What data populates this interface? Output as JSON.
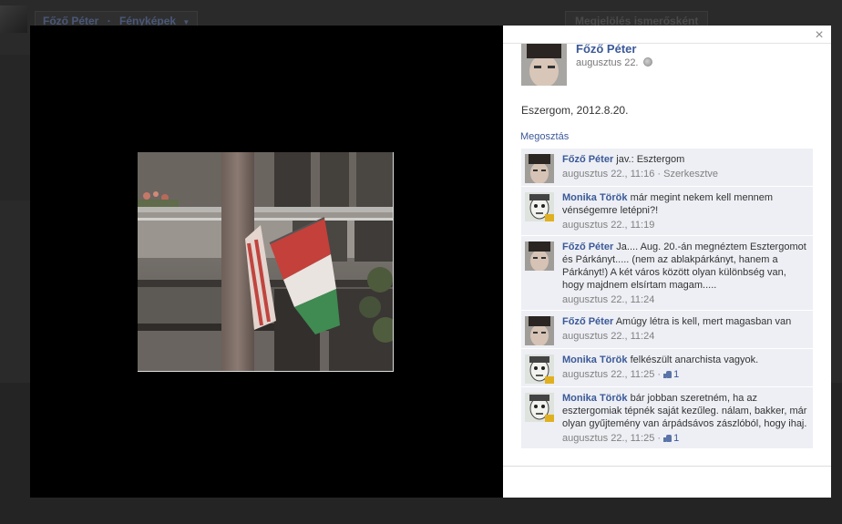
{
  "background": {
    "profile_name": "Főző Péter",
    "album_label": "Fényképek",
    "dropdown_glyph": "▼",
    "friend_button_label": "Megjelölés ismerősként"
  },
  "viewer": {
    "close_glyph": "×",
    "owner": {
      "name": "Főző Péter",
      "date": "augusztus 22."
    },
    "caption": "Eszergom, 2012.8.20.",
    "share_label": "Megosztás",
    "comments": [
      {
        "author": "Főző Péter",
        "text": "jav.: Esztergom",
        "time": "augusztus 22., 11:16",
        "extra": " · Szerkesztve",
        "likes": null
      },
      {
        "author": "Monika Török",
        "text": "már megint nekem kell mennem vénségemre letépni?!",
        "time": "augusztus 22., 11:19",
        "extra": "",
        "likes": null
      },
      {
        "author": "Főző Péter",
        "text": "Ja.... Aug. 20.-án megnéztem Esztergomot és Párkányt..... (nem az ablakpárkányt, hanem a Párkányt!) A két város között olyan különbség van, hogy majdnem elsírtam magam.....",
        "time": "augusztus 22., 11:24",
        "extra": "",
        "likes": null
      },
      {
        "author": "Főző Péter",
        "text": "Amúgy létra is kell, mert magasban van",
        "time": "augusztus 22., 11:24",
        "extra": "",
        "likes": null
      },
      {
        "author": "Monika Török",
        "text": "felkészült anarchista vagyok.",
        "time": "augusztus 22., 11:25",
        "extra": " ·",
        "likes": "1"
      },
      {
        "author": "Monika Török",
        "text": "bár jobban szeretném, ha az esztergomiak tépnék saját kezűleg. nálam, bakker, már olyan gyűjtemény van árpádsávos zászlóból, hogy ihaj.",
        "time": "augusztus 22., 11:25",
        "extra": " ·",
        "likes": "1"
      }
    ]
  },
  "colors": {
    "link": "#3b5998",
    "comment_bg": "#edeff4",
    "stage": "#000000"
  }
}
